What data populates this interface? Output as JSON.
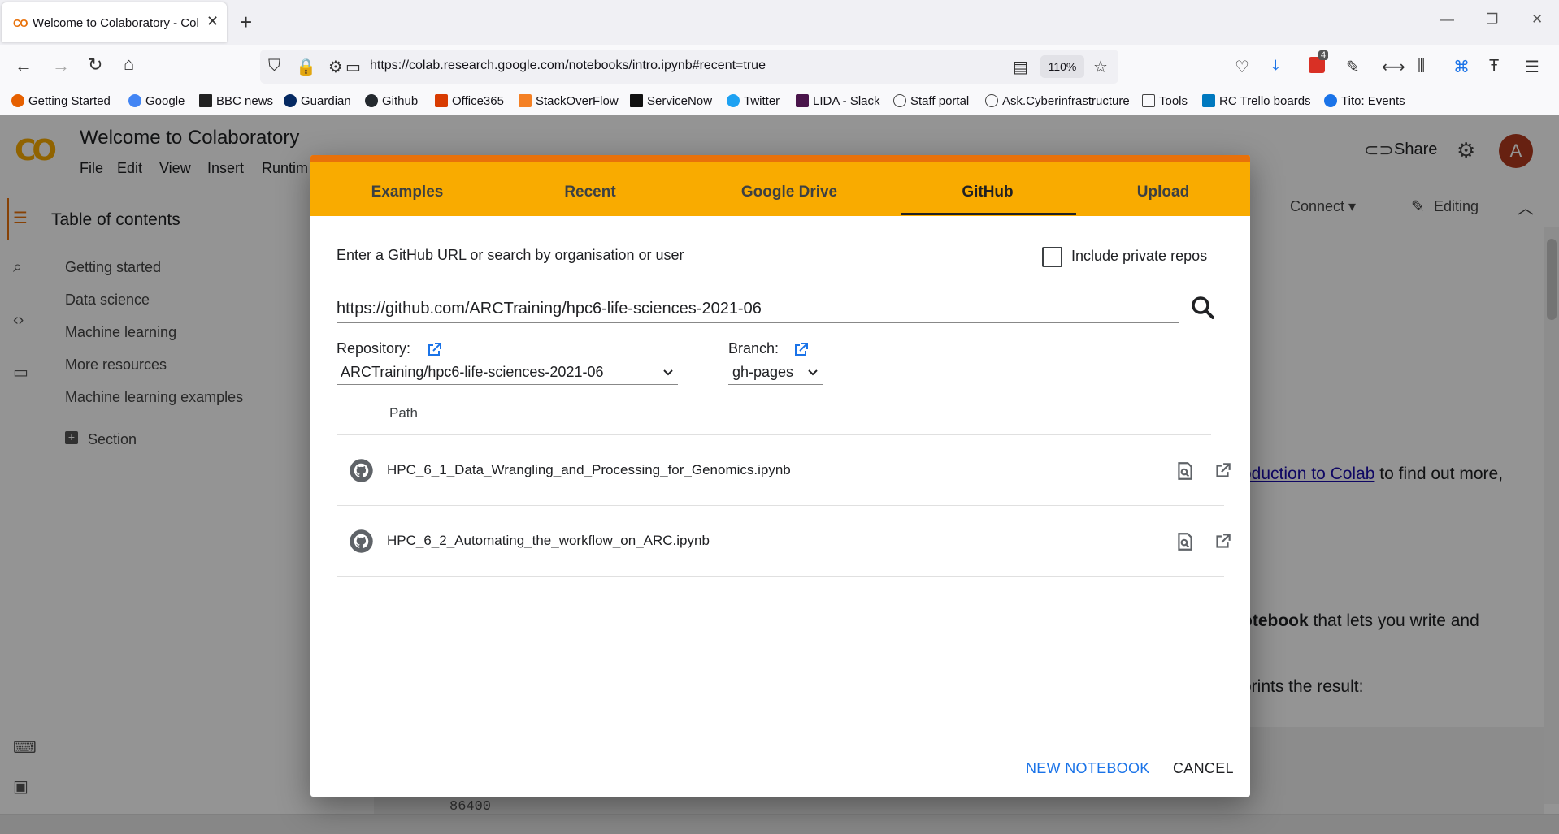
{
  "browser": {
    "tab_title": "Welcome to Colaboratory - Col",
    "url": "https://colab.research.google.com/notebooks/intro.ipynb#recent=true",
    "zoom": "110%",
    "badge_count": "4",
    "bookmarks": [
      "Getting Started",
      "Google",
      "BBC news",
      "Guardian",
      "Github",
      "Office365",
      "StackOverFlow",
      "ServiceNow",
      "Twitter",
      "LIDA - Slack",
      "Staff portal",
      "Ask.Cyberinfrastructure",
      "Tools",
      "RC Trello boards",
      "Tito: Events"
    ]
  },
  "colab": {
    "logo": "CO",
    "title": "Welcome to Colaboratory",
    "menu": [
      "File",
      "Edit",
      "View",
      "Insert",
      "Runtim"
    ],
    "share": "Share",
    "avatar": "A",
    "connect": "Connect",
    "editing": "Editing",
    "toc_title": "Table of contents",
    "toc": [
      "Getting started",
      "Data science",
      "Machine learning",
      "More resources",
      "Machine learning examples"
    ],
    "section": "Section",
    "bg_link": "oduction to Colab",
    "bg_text1": " to find out more,",
    "bg_bold": "otebook",
    "bg_text2": " that lets you write and",
    "bg_text3": "prints the result:",
    "code_output": "86400"
  },
  "dialog": {
    "tabs": [
      "Examples",
      "Recent",
      "Google Drive",
      "GitHub",
      "Upload"
    ],
    "active_tab": "GitHub",
    "search_hint": "Enter a GitHub URL or search by organisation or user",
    "private_label": "Include private repos",
    "url_value": "https://github.com/ARCTraining/hpc6-life-sciences-2021-06",
    "repo_label": "Repository:",
    "repo_value": "ARCTraining/hpc6-life-sciences-2021-06",
    "branch_label": "Branch:",
    "branch_value": "gh-pages",
    "path_header": "Path",
    "files": [
      "HPC_6_1_Data_Wrangling_and_Processing_for_Genomics.ipynb",
      "HPC_6_2_Automating_the_workflow_on_ARC.ipynb"
    ],
    "new_notebook": "NEW NOTEBOOK",
    "cancel": "CANCEL"
  },
  "colors": {
    "accent_orange": "#f9ab00",
    "accent_dark_orange": "#e8710a",
    "link_blue": "#1a73e8"
  }
}
